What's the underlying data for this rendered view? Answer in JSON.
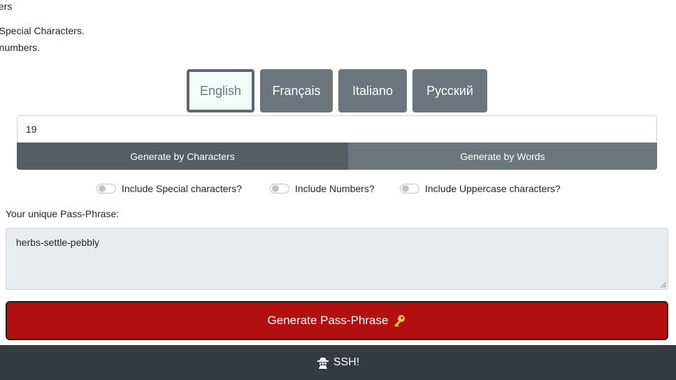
{
  "intro": {
    "line1": "cters",
    "line2": "e Special Characters.",
    "line3": "e numbers."
  },
  "languages": [
    {
      "label": "English",
      "active": true
    },
    {
      "label": "Français",
      "active": false
    },
    {
      "label": "Italiano",
      "active": false
    },
    {
      "label": "Русский",
      "active": false
    }
  ],
  "length_input": {
    "value": "19"
  },
  "modes": {
    "characters": "Generate by Characters",
    "words": "Generate by Words"
  },
  "options": {
    "special": "Include Special characters?",
    "numbers": "Include Numbers?",
    "uppercase": "Include Uppercase characters?"
  },
  "output": {
    "label": "Your unique Pass-Phrase:",
    "value": "herbs-settle-pebbly"
  },
  "generate_button": {
    "label": "Generate Pass-Phrase",
    "icon": "key-icon"
  },
  "footer": {
    "label": "SSH!",
    "icon": "spy-icon"
  },
  "colors": {
    "primary_red": "#b21010",
    "secondary": "#6c757d",
    "footer_bg": "#343a40"
  }
}
